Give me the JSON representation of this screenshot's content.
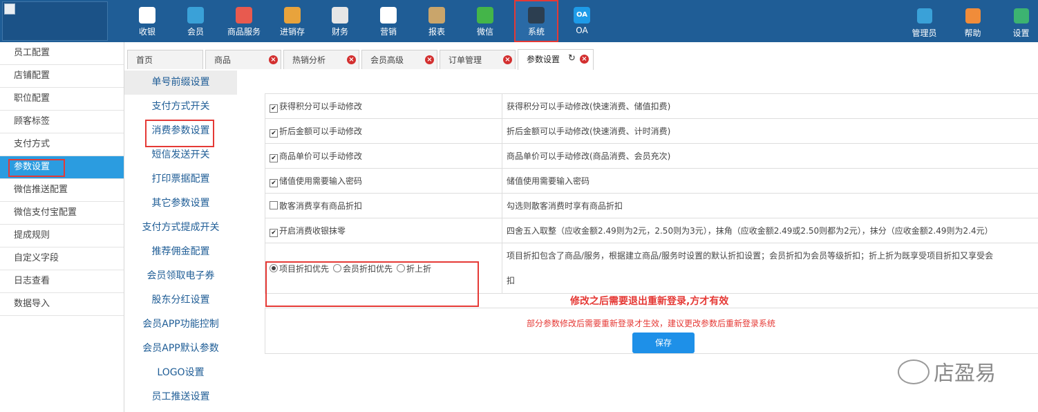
{
  "topnav": [
    {
      "label": "收银",
      "icon": "cash-register-icon",
      "color": "#ffffff"
    },
    {
      "label": "会员",
      "icon": "member-icon",
      "color": "#3aa1d8"
    },
    {
      "label": "商品服务",
      "icon": "goods-icon",
      "color": "#e85a4f"
    },
    {
      "label": "进销存",
      "icon": "inventory-icon",
      "color": "#e8a33c"
    },
    {
      "label": "财务",
      "icon": "finance-icon",
      "color": "#e6e6e6"
    },
    {
      "label": "营销",
      "icon": "marketing-icon",
      "color": "#ffffff"
    },
    {
      "label": "报表",
      "icon": "report-icon",
      "color": "#c9a56b"
    },
    {
      "label": "微信",
      "icon": "wechat-icon",
      "color": "#44b549"
    },
    {
      "label": "系统",
      "icon": "system-icon",
      "color": "#2c3e50",
      "active": true
    },
    {
      "label": "OA",
      "icon": "oa-icon",
      "color": "#1e9be8"
    }
  ],
  "rightnav": [
    {
      "label": "管理员",
      "icon": "admin-icon",
      "color": "#3aa1d8"
    },
    {
      "label": "帮助",
      "icon": "help-icon",
      "color": "#f08c3a"
    },
    {
      "label": "设置",
      "icon": "settings-icon",
      "color": "#3cb371"
    }
  ],
  "sidebar": [
    "员工配置",
    "店铺配置",
    "职位配置",
    "顾客标签",
    "支付方式",
    "参数设置",
    "微信推送配置",
    "微信支付宝配置",
    "提成规则",
    "自定义字段",
    "日志查看",
    "数据导入"
  ],
  "tabs": [
    {
      "label": "首页"
    },
    {
      "label": "商品"
    },
    {
      "label": "热销分析"
    },
    {
      "label": "会员高级"
    },
    {
      "label": "订单管理"
    },
    {
      "label": "参数设置",
      "active": true
    }
  ],
  "submenu": [
    "单号前缀设置",
    "支付方式开关",
    "消费参数设置",
    "短信发送开关",
    "打印票据配置",
    "其它参数设置",
    "支付方式提成开关",
    "推荐佣金配置",
    "会员领取电子券",
    "股东分红设置",
    "会员APP功能控制",
    "会员APP默认参数",
    "LOGO设置",
    "员工推送设置"
  ],
  "settings": [
    {
      "label": "获得积分可以手动修改",
      "checked": true,
      "desc": "获得积分可以手动修改(快速消费、储值扣费)"
    },
    {
      "label": "折后金额可以手动修改",
      "checked": true,
      "desc": "折后金额可以手动修改(快速消费、计时消费)"
    },
    {
      "label": "商品单价可以手动修改",
      "checked": true,
      "desc": "商品单价可以手动修改(商品消费、会员充次)"
    },
    {
      "label": "储值使用需要输入密码",
      "checked": true,
      "desc": "储值使用需要输入密码"
    },
    {
      "label": "散客消费享有商品折扣",
      "checked": false,
      "desc": "勾选则散客消费时享有商品折扣"
    },
    {
      "label": "开启消费收银抹零",
      "checked": true,
      "desc": "四舍五入取整（应收金额2.49则为2元，2.50则为3元），抹角（应收金额2.49或2.50则都为2元），抹分（应收金额2.49则为2.4元）"
    }
  ],
  "discount": {
    "options": [
      "项目折扣优先",
      "会员折扣优先",
      "折上折"
    ],
    "selected": 0,
    "desc_line1": "项目折扣包含了商品/服务，根据建立商品/服务时设置的默认折扣设置；会员折扣为会员等级折扣；折上折为既享受项目折扣又享受会",
    "desc_line2": "扣"
  },
  "notice_bold": "修改之后需要退出重新登录,方才有效",
  "notice": "部分参数修改后需要重新登录才生效，建议更改参数后重新登录系统",
  "save_label": "保存",
  "watermark": "店盈易"
}
